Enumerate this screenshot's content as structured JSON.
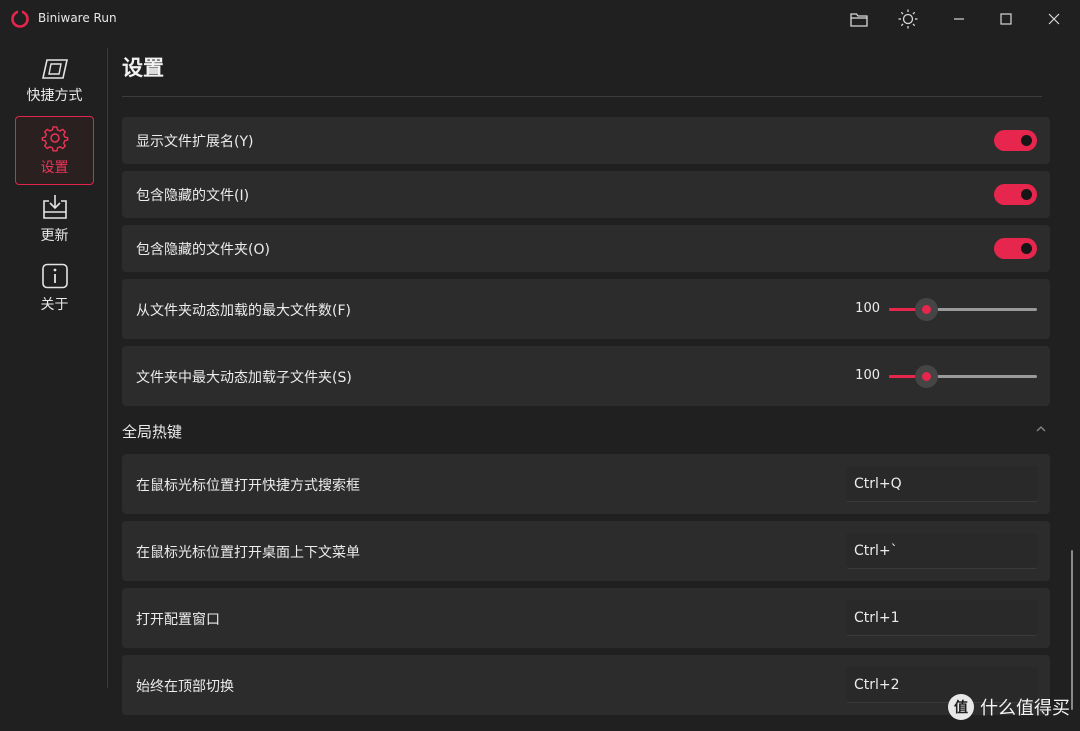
{
  "window": {
    "title": "Biniware Run",
    "buttons": [
      "folder-icon",
      "theme-icon",
      "minimize-icon",
      "maximize-icon",
      "close-icon"
    ]
  },
  "sidebar": {
    "items": [
      {
        "label": "快捷方式",
        "icon": "shortcut-icon",
        "active": false
      },
      {
        "label": "设置",
        "icon": "gear-icon",
        "active": true
      },
      {
        "label": "更新",
        "icon": "download-icon",
        "active": false
      },
      {
        "label": "关于",
        "icon": "info-icon",
        "active": false
      }
    ]
  },
  "page": {
    "title": "设置"
  },
  "settings": {
    "toggles": [
      {
        "label": "显示文件扩展名(Y)",
        "on": true
      },
      {
        "label": "包含隐藏的文件(I)",
        "on": true
      },
      {
        "label": "包含隐藏的文件夹(O)",
        "on": true
      }
    ],
    "sliders": [
      {
        "label": "从文件夹动态加载的最大文件数(F)",
        "value": "100"
      },
      {
        "label": "文件夹中最大动态加载子文件夹(S)",
        "value": "100"
      }
    ]
  },
  "hotkeys": {
    "section_title": "全局热键",
    "items": [
      {
        "label": "在鼠标光标位置打开快捷方式搜索框",
        "value": "Ctrl+Q"
      },
      {
        "label": "在鼠标光标位置打开桌面上下文菜单",
        "value": "Ctrl+`"
      },
      {
        "label": "打开配置窗口",
        "value": "Ctrl+1"
      },
      {
        "label": "始终在顶部切换",
        "value": "Ctrl+2"
      }
    ]
  },
  "colors": {
    "accent": "#e6264c",
    "background": "#202020",
    "card": "#2c2c2c"
  },
  "watermark": {
    "text": "什么值得买",
    "mark": "值"
  }
}
